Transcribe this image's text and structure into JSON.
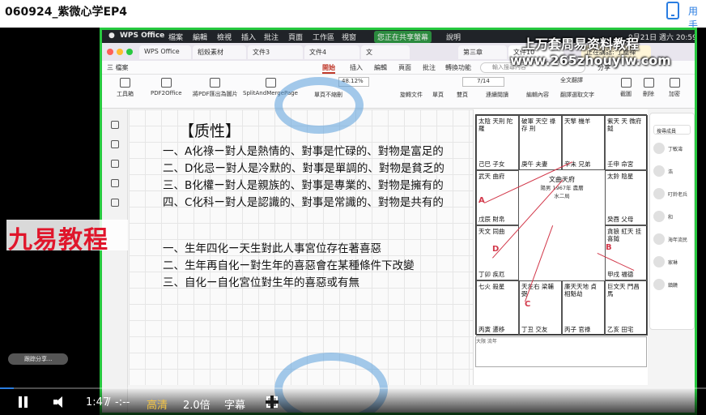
{
  "page": {
    "title": "060924_紫微心学EP4",
    "phone_label": "用手"
  },
  "mac_menu": {
    "app": "WPS Office",
    "items": [
      "檔案",
      "編輯",
      "檢視",
      "插入",
      "批注",
      "頁面",
      "工作區",
      "視窗"
    ],
    "help": "說明",
    "sharing": "您正在共享螢幕",
    "clock": "9月21日 週六 20:59"
  },
  "wps_tabs": [
    "WPS Office",
    "稻殼素材",
    "文件3",
    "文件4",
    "文",
    "第三章",
    "文件10"
  ],
  "wps_status": "正在講話: 了塵禪",
  "menu": {
    "items": [
      "三 檔案",
      "開始",
      "插入",
      "編輯",
      "頁面",
      "批注",
      "轉換功能"
    ],
    "selected": "開始",
    "search": "輸入搜尋內容",
    "share": "分享"
  },
  "toolbar": {
    "tools": [
      "工具箱",
      "PDF2Office",
      "將PDF匯出為圖片",
      "SplitAndMergePage",
      "單頁不縮刪",
      "旋轉文件",
      "單頁",
      "雙頁",
      "連續閱讀",
      "編輯內容",
      "翻譯選取文字",
      "截圖",
      "刪除",
      "加密"
    ],
    "zoom": "48.12%",
    "page": "7/14",
    "replace": "全文翻譯"
  },
  "doc": {
    "heading": "【质性】",
    "lines": [
      "一、A化祿ー對人是熱情的、對事是忙碌的、對物是富足的",
      "二、D化忌ー對人是冷默的、對事是單調的、對物是貧乏的",
      "三、B化權ー對人是親族的、對事是專業的、對物是擁有的",
      "四、C化科ー對人是認識的、對事是常識的、對物是共有的",
      "一、生年四化ー天生對此人事宮位存在著喜惡",
      "二、生年再自化ー對生年的喜惡會在某種條件下改變",
      "三、自化ー自化宮位對生年的喜惡或有無"
    ]
  },
  "brand": "九易教程",
  "watermark": {
    "line1": "上万套周易资料教程",
    "line2": "www.265zhouyiw.com"
  },
  "chart": {
    "palaces": [
      {
        "stars": "太陰 天刑 陀羅",
        "name": "己巳 子女"
      },
      {
        "stars": "破軍 天空 祿存 刑",
        "name": "庚午 夫妻"
      },
      {
        "stars": "天擎 機羊",
        "name": "辛未 兄弟"
      },
      {
        "stars": "紫天 天 微府 鉞",
        "name": "壬申 命宮"
      },
      {
        "stars": "武天 曲府",
        "name": "戊辰 財帛"
      },
      {
        "stars": "太鈴 陰星",
        "name": "癸酉 父母"
      },
      {
        "stars": "天文 同曲",
        "name": "丁卯 疾厄"
      },
      {
        "stars": "貪狼 紅天 挂 喜鉞",
        "name": "甲戌 福德"
      },
      {
        "stars": "七火 殺星",
        "name": "丙寅 遷移"
      },
      {
        "stars": "天左右 梁輔弼",
        "name": "丁丑 交友"
      },
      {
        "stars": "廉天天地 貞相魁劫",
        "name": "丙子 官祿"
      },
      {
        "stars": "巨文天 門昌馬",
        "name": "乙亥 田宅"
      }
    ],
    "center": {
      "title": "文曲天府",
      "info": "陽男 1967年 農曆",
      "note": "水二局"
    },
    "letters": [
      "A",
      "B",
      "C",
      "D"
    ],
    "footer": "大限 流年"
  },
  "chat": {
    "search": "搜尋成員",
    "members": [
      "丁敏濤",
      "浩",
      "叮鈴老兵",
      "和",
      "海年流民",
      "家琳",
      "鎮饒"
    ]
  },
  "pill": "跟踪分享...",
  "player": {
    "time_current": "1:47",
    "time_total": "-:--",
    "quality": "高清",
    "speed": "2.0倍",
    "subtitle": "字幕",
    "progress": 0.02
  }
}
